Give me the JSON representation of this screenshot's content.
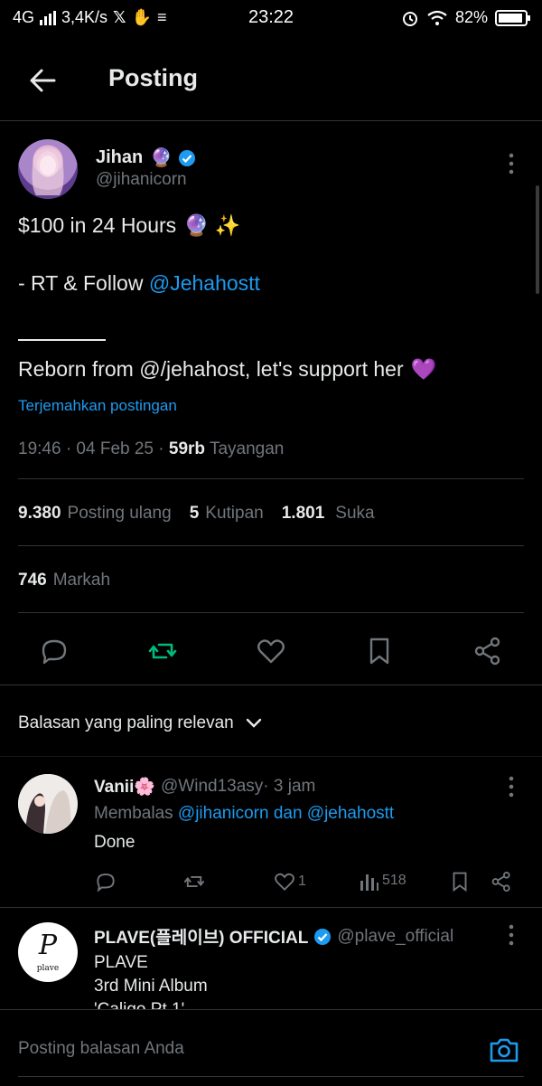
{
  "status_bar": {
    "network": "4G",
    "speed": "3,4K/s",
    "time": "23:22",
    "battery": "82%"
  },
  "header": {
    "title": "Posting"
  },
  "post": {
    "author_name": "Jihan",
    "author_handle": "@jihanicorn",
    "line1": "$100 in 24 Hours",
    "line2_prefix": "- RT & Follow ",
    "line2_mention": "@Jehahostt",
    "line3": "Reborn from @/jehahost, let's support her",
    "translate": "Terjemahkan postingan",
    "meta_time": "19:46 · 04 Feb 25 · ",
    "views_num": "59rb",
    "views_label": " Tayangan",
    "stats": {
      "reposts_num": "9.380",
      "reposts_label": "Posting ulang",
      "quotes_num": "5",
      "quotes_label": "Kutipan",
      "likes_num": "1.801",
      "likes_label": "Suka",
      "bookmarks_num": "746",
      "bookmarks_label": "Markah"
    }
  },
  "replies_sort": "Balasan yang paling relevan",
  "replies": [
    {
      "name": "Vanii🌸",
      "handle": "@Wind13asy",
      "time": " · 3 jam",
      "reply_prefix": "Membalas ",
      "reply_targets": "@jihanicorn dan @jehahostt",
      "text": "Done",
      "likes": "1",
      "views": "518"
    },
    {
      "name": "PLAVE(플레이브) OFFICIAL",
      "handle": "@plave_official",
      "avatar_text": "plave",
      "body_1": "PLAVE",
      "body_2": "3rd Mini Album",
      "body_3": "'Caligo Pt.1'"
    }
  ],
  "composer": {
    "placeholder": "Posting balasan Anda"
  },
  "colors": {
    "accent": "#1d9bf0",
    "repost_active": "#00ba7c",
    "muted": "#71767b",
    "background": "#000000"
  }
}
